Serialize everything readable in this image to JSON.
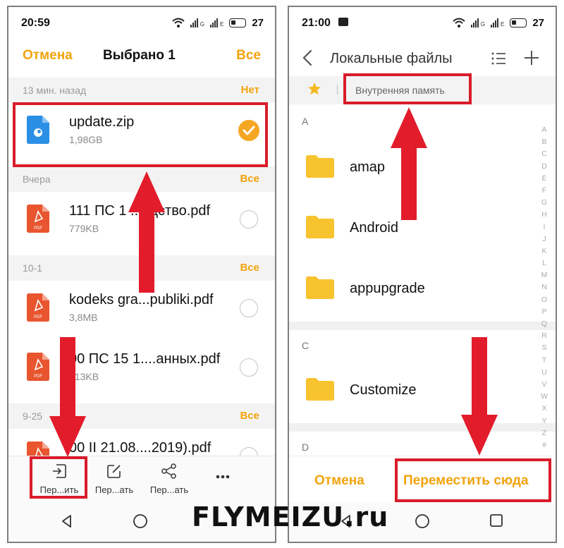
{
  "left": {
    "status": {
      "time": "20:59",
      "battery": "27"
    },
    "header": {
      "cancel": "Отмена",
      "title": "Выбрано 1",
      "select_all": "Все"
    },
    "sections": [
      {
        "label": "13 мин. назад",
        "action": "Нет"
      },
      {
        "label": "Вчера",
        "action": "Все"
      },
      {
        "label": "10-1",
        "action": "Все"
      },
      {
        "label": "9-25",
        "action": "Все"
      }
    ],
    "files": [
      {
        "name": "update.zip",
        "size": "1,98GB",
        "selected": true
      },
      {
        "name": "111 ПС 1 ...одство.pdf",
        "size": "779KB",
        "selected": false
      },
      {
        "name": "kodeks gra...publiki.pdf",
        "size": "3,8MB",
        "selected": false
      },
      {
        "name": "00 ПС 15 1....анных.pdf",
        "size": "313KB",
        "selected": false
      },
      {
        "name": "00 II 21.08....2019).pdf",
        "size": "",
        "selected": false
      }
    ],
    "pdf_badge": "PDF",
    "bottom_actions": [
      {
        "label": "Пер...ить",
        "icon": "move-icon"
      },
      {
        "label": "Пер...ать",
        "icon": "edit-icon"
      },
      {
        "label": "Пер...ать",
        "icon": "share-icon"
      },
      {
        "label": "",
        "icon": "more-icon"
      }
    ]
  },
  "right": {
    "status": {
      "time": "21:00",
      "battery": "27"
    },
    "header": {
      "title": "Локальные файлы"
    },
    "path": {
      "label": "Внутренняя память"
    },
    "groups": [
      {
        "letter": "A",
        "folders": [
          "amap",
          "Android",
          "appupgrade"
        ]
      },
      {
        "letter": "C",
        "folders": [
          "Customize"
        ]
      },
      {
        "letter": "D",
        "folders": []
      }
    ],
    "alphabet": [
      "A",
      "B",
      "C",
      "D",
      "E",
      "F",
      "G",
      "H",
      "I",
      "J",
      "K",
      "L",
      "M",
      "N",
      "O",
      "P",
      "Q",
      "R",
      "S",
      "T",
      "U",
      "V",
      "W",
      "X",
      "Y",
      "Z",
      "#"
    ],
    "actions": {
      "cancel": "Отмена",
      "move_here": "Переместить сюда"
    }
  },
  "watermark": "FLYMEIZU.ru",
  "colors": {
    "accent": "#f2a30c",
    "annotation": "#d91c2a",
    "folder": "#f7c32f",
    "pdf": "#e8552f",
    "zip": "#2b8fe6"
  }
}
